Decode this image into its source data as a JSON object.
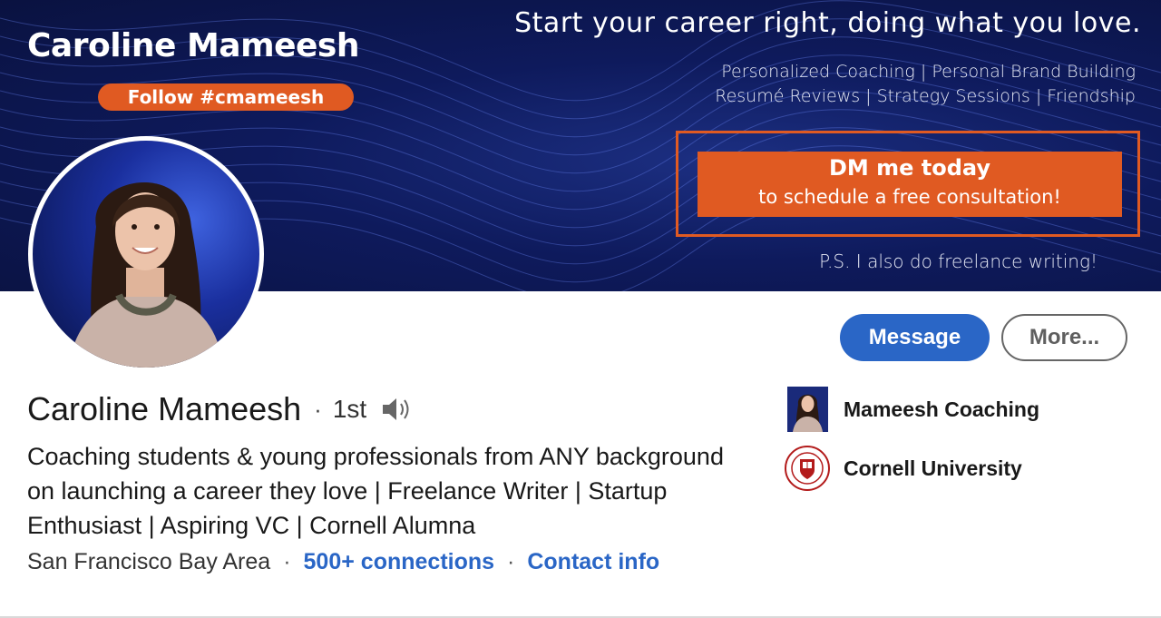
{
  "banner": {
    "name": "Caroline Mameesh",
    "follow_label": "Follow #cmameesh",
    "tagline": "Start your career right, doing what you love.",
    "services_line1": "Personalized Coaching | Personal Brand Building",
    "services_line2": "Resumé Reviews | Strategy Sessions | Friendship",
    "cta_title": "DM me today",
    "cta_subtitle": "to schedule a free consultation!",
    "ps_note": "P.S. I also do freelance writing!"
  },
  "actions": {
    "message_label": "Message",
    "more_label": "More..."
  },
  "profile": {
    "name": "Caroline Mameesh",
    "degree": "1st",
    "headline": "Coaching students & young professionals from ANY background on launching a career they love | Freelance Writer | Startup Enthusiast | Aspiring VC | Cornell Alumna",
    "location": "San Francisco Bay Area",
    "connections_label": "500+ connections",
    "contact_label": "Contact info"
  },
  "organizations": [
    {
      "name": "Mameesh Coaching",
      "icon": "company-logo"
    },
    {
      "name": "Cornell University",
      "icon": "cornell-seal-logo"
    }
  ],
  "colors": {
    "banner_navy": "#0e1a5c",
    "accent_orange": "#e05a22",
    "primary_blue": "#2a66c6"
  }
}
